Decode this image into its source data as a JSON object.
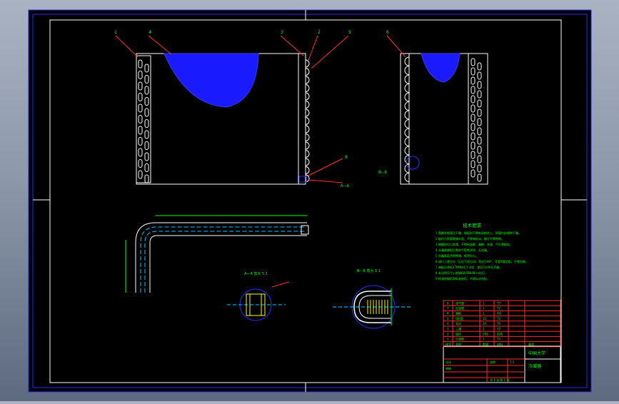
{
  "drawing": {
    "colors": {
      "background": "#000000",
      "border_outer": "#2a2aff",
      "frame": "#ffffff",
      "annotation": "#00ff00",
      "leader": "#ff2a2a",
      "hatch": "#1a1aff",
      "tube": "#ffffff",
      "centerline": "#00c8ff",
      "highlight": "#ffff00"
    },
    "balloons": {
      "front_top": [
        "1",
        "4",
        "3",
        "2",
        "5"
      ],
      "front_bottom": [
        "8"
      ],
      "side_top": [
        "6"
      ]
    },
    "section_labels": {
      "front": "A—A",
      "side": "B—B",
      "detail_a": "A—A  放大 5:1",
      "detail_b": "B—B  放大 1:1"
    },
    "tech_requirements": {
      "title": "技术要求",
      "items": [
        "1.管路系统清洁干燥，装配时不得有异物进入，铜管内部保持干燥。",
        "2.翅片与铜管胀接牢固，不得有松动，翅片不得倒伏。",
        "3.焊缝应均匀饱满，不得有虚焊、漏焊、夹渣、气孔等缺陷。",
        "4.冷凝器装配后需作气密性试验，无泄漏。",
        "5.外露表面涂防锈漆，喷涂均匀。",
        "6.进口三通方向（见出气流方向）弯头为90°，弯管R值见图，不得压扁。",
        "7.装配后进行2.5MPa压力试验，保压5分钟无泄漏。",
        "8.未注明尺寸公差按GB/T1804-m执行。",
        "9.标准件按国家标准选用，不得以次充好。"
      ]
    },
    "parts_list": [
      {
        "no": "8",
        "name": "进气管",
        "qty": "1",
        "material": "T2"
      },
      {
        "no": "7",
        "name": "出液管",
        "qty": "1",
        "material": "T2"
      },
      {
        "no": "6",
        "name": "端板",
        "qty": "2",
        "material": "A3"
      },
      {
        "no": "5",
        "name": "U形管",
        "qty": "32",
        "material": "T2"
      },
      {
        "no": "4",
        "name": "弯头",
        "qty": "30",
        "material": "T2"
      },
      {
        "no": "3",
        "name": "三通",
        "qty": "2",
        "material": "T2"
      },
      {
        "no": "2",
        "name": "翅片",
        "qty": "260",
        "material": "铝箔"
      },
      {
        "no": "1",
        "name": "分液管",
        "qty": "1",
        "material": "T2"
      }
    ],
    "parts_header": {
      "no": "序号",
      "name": "名称",
      "qty": "数量",
      "material": "材料",
      "note": "备注"
    },
    "title_block": {
      "school": "中国大学",
      "drawing_name": "冷凝器",
      "scale_label": "比例",
      "scale": "1:1",
      "sheet": "共 1 张  第 1 张",
      "designer_label": "设计",
      "checker_label": "审核"
    }
  }
}
